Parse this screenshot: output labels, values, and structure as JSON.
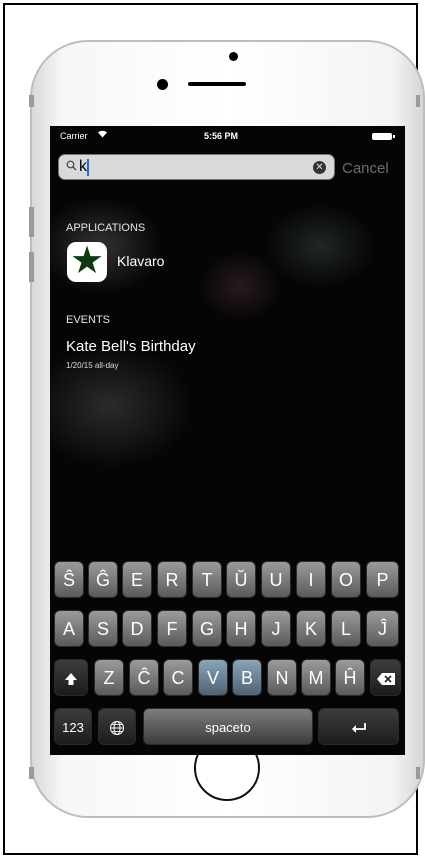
{
  "status_bar": {
    "carrier": "Carrier",
    "wifi_icon": "wifi-icon",
    "time": "5:56 PM",
    "battery_icon": "battery-icon"
  },
  "search": {
    "icon": "search-icon",
    "value": "k",
    "clear_icon": "clear-icon",
    "cancel_label": "Cancel"
  },
  "sections": {
    "applications": {
      "header": "APPLICATIONS",
      "app_name": "Klavaro",
      "app_icon": "star-icon"
    },
    "events": {
      "header": "EVENTS",
      "title": "Kate Bell's Birthday",
      "subtitle": "1/20/15 all-day"
    }
  },
  "keyboard": {
    "row1": [
      "Ŝ",
      "Ĝ",
      "E",
      "R",
      "T",
      "Ŭ",
      "U",
      "I",
      "O",
      "P"
    ],
    "row2": [
      "A",
      "S",
      "D",
      "F",
      "G",
      "H",
      "J",
      "K",
      "L",
      "Ĵ"
    ],
    "row3": [
      "Z",
      "Ĉ",
      "C",
      "V",
      "B",
      "N",
      "M",
      "Ĥ"
    ],
    "shift_icon": "shift-icon",
    "delete_icon": "delete-icon",
    "numbers_label": "123",
    "globe_icon": "globe-icon",
    "space_label": "spaceto",
    "return_icon": "return-icon"
  }
}
